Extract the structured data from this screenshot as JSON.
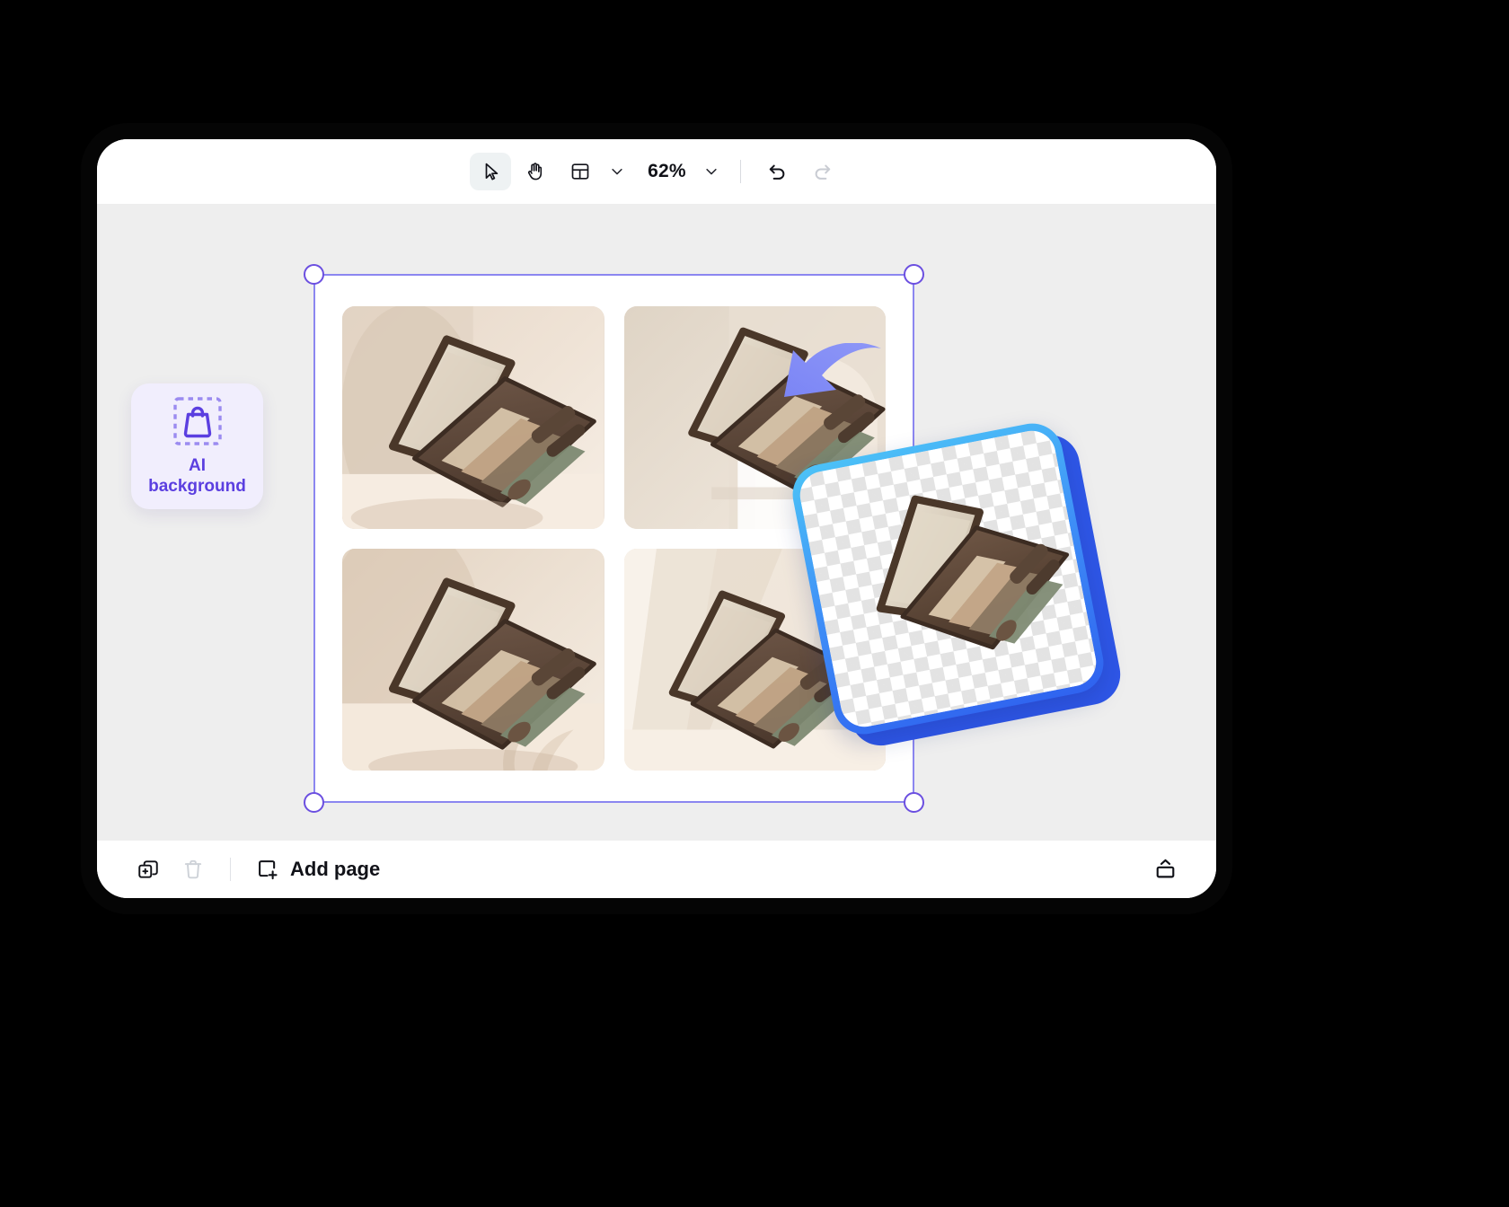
{
  "app": {
    "window_title": "Photo editor canvas"
  },
  "toolbar": {
    "select_tool": {
      "label": "Select",
      "icon": "cursor-arrow-icon",
      "active": true
    },
    "hand_tool": {
      "label": "Pan",
      "icon": "hand-icon",
      "active": false
    },
    "layout_tool": {
      "label": "Layout",
      "icon": "layout-grid-icon"
    },
    "layout_chevron": {
      "icon": "chevron-down-icon"
    },
    "zoom_level": "62%",
    "zoom_chevron": {
      "icon": "chevron-down-icon"
    },
    "undo": {
      "label": "Undo",
      "icon": "undo-arrow-icon",
      "enabled": true
    },
    "redo": {
      "label": "Redo",
      "icon": "redo-arrow-icon",
      "enabled": false
    }
  },
  "ai_chip": {
    "icon": "ai-background-bag-icon",
    "label_line1": "AI",
    "label_line2": "background",
    "accent_color": "#5b3fe0",
    "background_color": "#f1eefd"
  },
  "canvas": {
    "background_color": "#eeeeee",
    "page_background": "#ffffff",
    "selection_color": "#8b86f0",
    "handle_border_color": "#6b4fe0",
    "handles": [
      "top-left",
      "top-right",
      "bottom-left",
      "bottom-right"
    ],
    "thumbnails": [
      {
        "alt": "Eyeshadow palette on beige backdrop with arch shadow"
      },
      {
        "alt": "Eyeshadow palette on cream pedestal with arch"
      },
      {
        "alt": "Eyeshadow palette with leaf shadow on warm beige"
      },
      {
        "alt": "Eyeshadow palette on bright cream block background"
      }
    ]
  },
  "cutout": {
    "alt": "Eyeshadow palette cut out on transparent checkerboard",
    "border_gradient_from": "#4cc3f7",
    "border_gradient_to": "#2f62ef",
    "shadow_color": "#2f57e8",
    "checker_light": "#ffffff",
    "checker_dark": "#e3e3e3"
  },
  "arrow": {
    "icon": "curved-arrow-icon",
    "color": "#6e79f0"
  },
  "bottombar": {
    "duplicate": {
      "label": "Duplicate",
      "icon": "duplicate-icon",
      "enabled": true
    },
    "delete": {
      "label": "Delete",
      "icon": "trash-icon",
      "enabled": false
    },
    "add_page": {
      "label": "Add page",
      "icon": "add-page-icon"
    },
    "export": {
      "label": "Export",
      "icon": "export-upload-icon"
    }
  }
}
